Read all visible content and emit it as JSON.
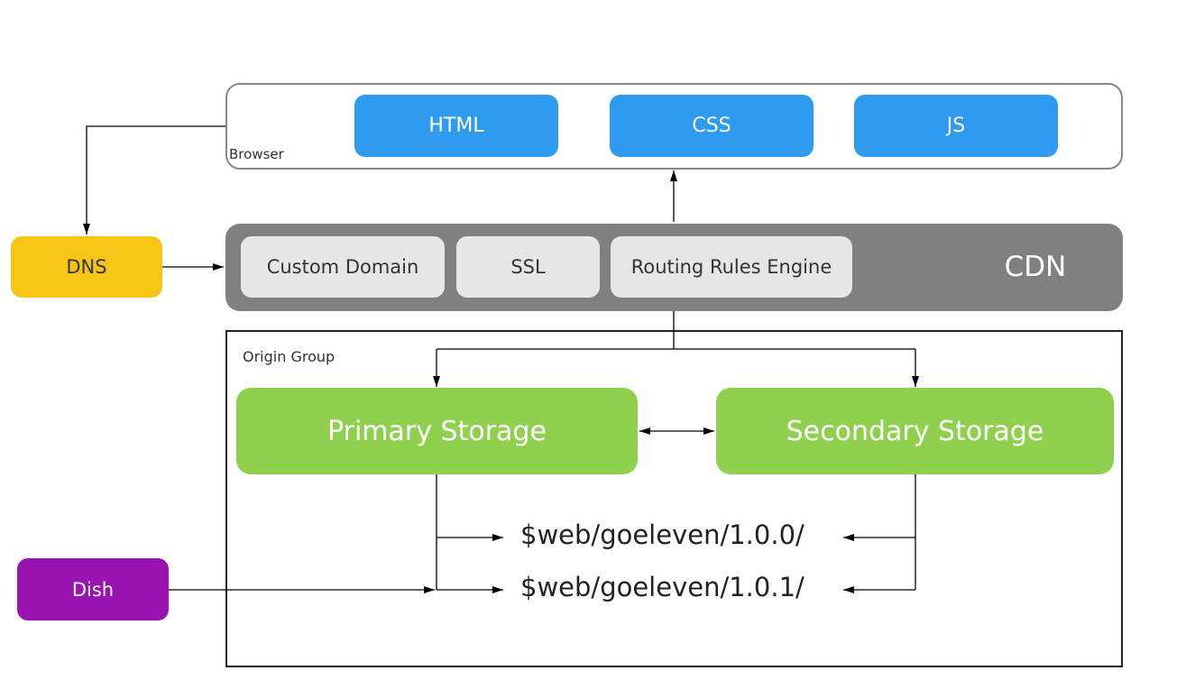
{
  "browser": {
    "label": "Browser",
    "items": [
      "HTML",
      "CSS",
      "JS"
    ]
  },
  "cdn": {
    "label": "CDN",
    "items": [
      "Custom Domain",
      "SSL",
      "Routing Rules Engine"
    ]
  },
  "dns": {
    "label": "DNS"
  },
  "dish": {
    "label": "Dish"
  },
  "origin_group": {
    "label": "Origin Group",
    "primary": "Primary Storage",
    "secondary": "Secondary Storage"
  },
  "paths": [
    "$web/goeleven/1.0.0/",
    "$web/goeleven/1.0.1/"
  ],
  "colors": {
    "browser_item": "#2e9bef",
    "cdn": "#808080",
    "cdn_item": "#e6e6e6",
    "dns": "#f7c514",
    "storage": "#8fd14f",
    "dish": "#9a13b0"
  }
}
